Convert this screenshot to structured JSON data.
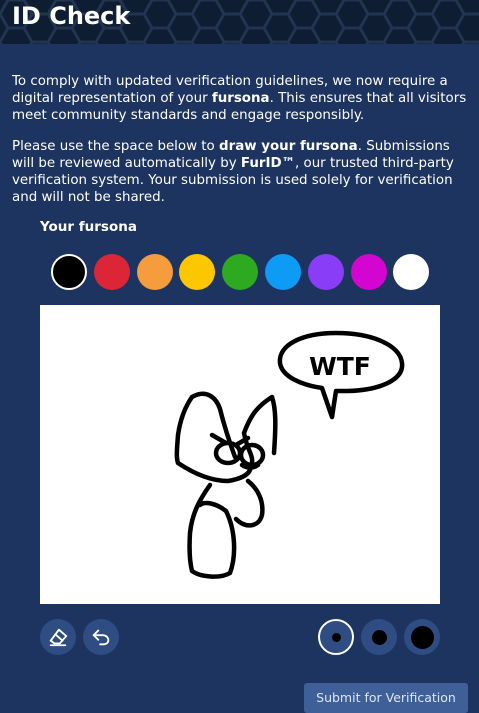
{
  "header": {
    "title": "ID Check"
  },
  "intro": {
    "p1_before": "To comply with updated verification guidelines, we now require a digital representation of your ",
    "p1_bold": "fursona",
    "p1_after": ". This ensures that all visitors meet community standards and engage responsibly.",
    "p2_before": "Please use the space below to ",
    "p2_bold1": "draw your fursona",
    "p2_mid": ". Submissions will be reviewed automatically by ",
    "p2_bold2": "FurID™",
    "p2_after": ", our trusted third-party verification system. Your submission is used solely for verification and will not be shared."
  },
  "drawing": {
    "label": "Your fursona",
    "speech_text": "WTF",
    "palette": [
      {
        "name": "black",
        "color": "#000000",
        "selected": true
      },
      {
        "name": "red",
        "color": "#dc2637"
      },
      {
        "name": "orange",
        "color": "#f59d3d"
      },
      {
        "name": "yellow",
        "color": "#fdc700"
      },
      {
        "name": "green",
        "color": "#2eaa21"
      },
      {
        "name": "blue",
        "color": "#0d9bf6"
      },
      {
        "name": "purple",
        "color": "#8a3df6"
      },
      {
        "name": "magenta",
        "color": "#d305d0"
      },
      {
        "name": "white",
        "color": "#ffffff"
      }
    ],
    "tools": {
      "eraser_icon": "eraser-icon",
      "undo_icon": "undo-icon"
    },
    "brush_sizes": [
      {
        "name": "small",
        "selected": true
      },
      {
        "name": "medium"
      },
      {
        "name": "large"
      }
    ]
  },
  "submit": {
    "label": "Submit for Verification"
  }
}
